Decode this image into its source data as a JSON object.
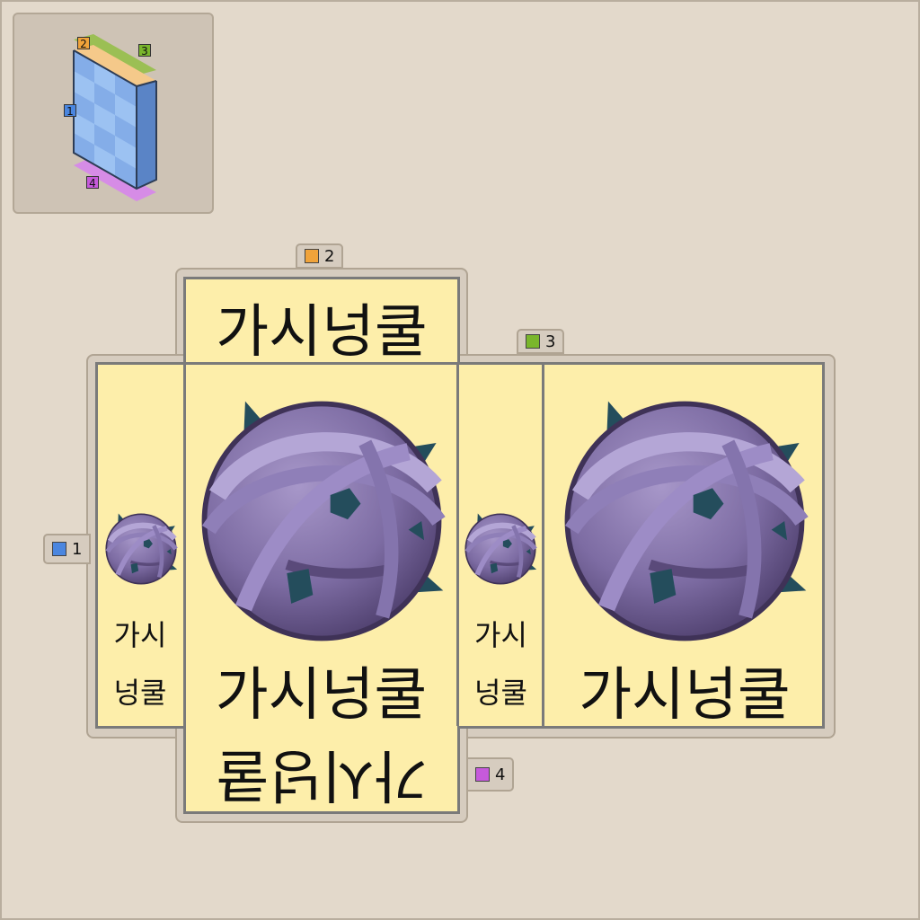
{
  "preview": {
    "faces": [
      {
        "id": "1",
        "color": "#4a86e0"
      },
      {
        "id": "2",
        "color": "#f0a33a"
      },
      {
        "id": "3",
        "color": "#7ab62c"
      },
      {
        "id": "4",
        "color": "#c65adb"
      }
    ]
  },
  "labels": {
    "face1": "1",
    "face2": "2",
    "face3": "3",
    "face4": "4"
  },
  "texts": {
    "top": "가시넝쿨",
    "front_main": "가시넝쿨",
    "back_main": "가시넝쿨",
    "bottom": "가시넝쿨",
    "left_line1": "가시",
    "left_line2": "넝쿨",
    "right_line1": "가시",
    "right_line2": "넝쿨"
  },
  "icon": "thorn-vine-ball-icon"
}
